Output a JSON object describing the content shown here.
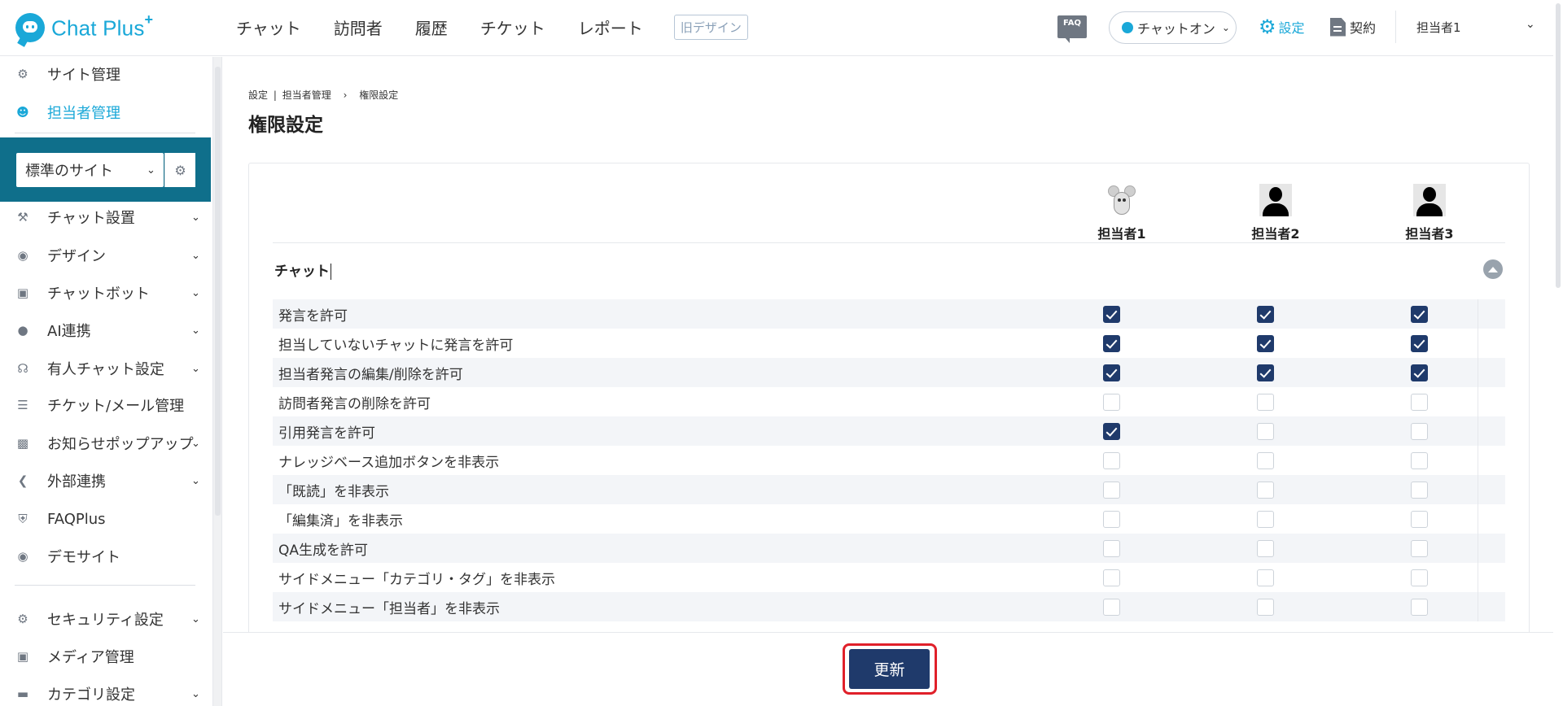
{
  "brand": {
    "name": "Chat Plus",
    "sup": "+"
  },
  "nav": {
    "items": [
      "チャット",
      "訪問者",
      "履歴",
      "チケット",
      "レポート"
    ],
    "old_design": "旧デザイン"
  },
  "header": {
    "faq": "FAQ",
    "chat_status": "チャットオン",
    "settings": "設定",
    "contract": "契約",
    "user": "担当者1"
  },
  "sidebar": {
    "top_items": [
      {
        "label": "サイト管理",
        "icon": "gear-icon"
      },
      {
        "label": "担当者管理",
        "icon": "users-icon",
        "active": true
      }
    ],
    "site_select": "標準のサイト",
    "menu_items": [
      {
        "label": "チャット設置",
        "icon": "tools-icon",
        "chevron": true
      },
      {
        "label": "デザイン",
        "icon": "palette-icon",
        "chevron": true
      },
      {
        "label": "チャットボット",
        "icon": "chat-bubble-icon",
        "chevron": true
      },
      {
        "label": "AI連携",
        "icon": "bulb-icon",
        "chevron": true
      },
      {
        "label": "有人チャット設定",
        "icon": "headset-icon",
        "chevron": true
      },
      {
        "label": "チケット/メール管理",
        "icon": "list-icon",
        "chevron": false
      },
      {
        "label": "お知らせポップアップ",
        "icon": "popup-icon",
        "chevron": true
      },
      {
        "label": "外部連携",
        "icon": "share-icon",
        "chevron": true
      },
      {
        "label": "FAQPlus",
        "icon": "faq-shield-icon",
        "chevron": false
      },
      {
        "label": "デモサイト",
        "icon": "eye-icon",
        "chevron": false
      }
    ],
    "bottom_items": [
      {
        "label": "セキュリティ設定",
        "icon": "security-icon",
        "chevron": true
      },
      {
        "label": "メディア管理",
        "icon": "image-icon",
        "chevron": false
      },
      {
        "label": "カテゴリ設定",
        "icon": "folder-icon",
        "chevron": true
      }
    ]
  },
  "breadcrumb": {
    "root": "設定",
    "parent": "担当者管理",
    "current": "権限設定"
  },
  "page": {
    "title": "権限設定"
  },
  "agents": [
    {
      "name": "担当者1",
      "avatar": "mouse"
    },
    {
      "name": "担当者2",
      "avatar": "person"
    },
    {
      "name": "担当者3",
      "avatar": "person"
    }
  ],
  "section": {
    "title": "チャット"
  },
  "permissions": [
    {
      "label": "発言を許可",
      "values": [
        true,
        true,
        true
      ]
    },
    {
      "label": "担当していないチャットに発言を許可",
      "values": [
        true,
        true,
        true
      ]
    },
    {
      "label": "担当者発言の編集/削除を許可",
      "values": [
        true,
        true,
        true
      ]
    },
    {
      "label": "訪問者発言の削除を許可",
      "values": [
        false,
        false,
        false
      ]
    },
    {
      "label": "引用発言を許可",
      "values": [
        true,
        false,
        false
      ]
    },
    {
      "label": "ナレッジベース追加ボタンを非表示",
      "values": [
        false,
        false,
        false
      ]
    },
    {
      "label": "「既読」を非表示",
      "values": [
        false,
        false,
        false
      ]
    },
    {
      "label": "「編集済」を非表示",
      "values": [
        false,
        false,
        false
      ]
    },
    {
      "label": "QA生成を許可",
      "values": [
        false,
        false,
        false
      ]
    },
    {
      "label": "サイドメニュー「カテゴリ・タグ」を非表示",
      "values": [
        false,
        false,
        false
      ]
    },
    {
      "label": "サイドメニュー「担当者」を非表示",
      "values": [
        false,
        false,
        false
      ]
    }
  ],
  "footer": {
    "update": "更新"
  },
  "colors": {
    "accent": "#1aa8d8",
    "primary": "#1f3a6b",
    "site_box": "#0f6f8b",
    "highlight": "#e0202a"
  }
}
